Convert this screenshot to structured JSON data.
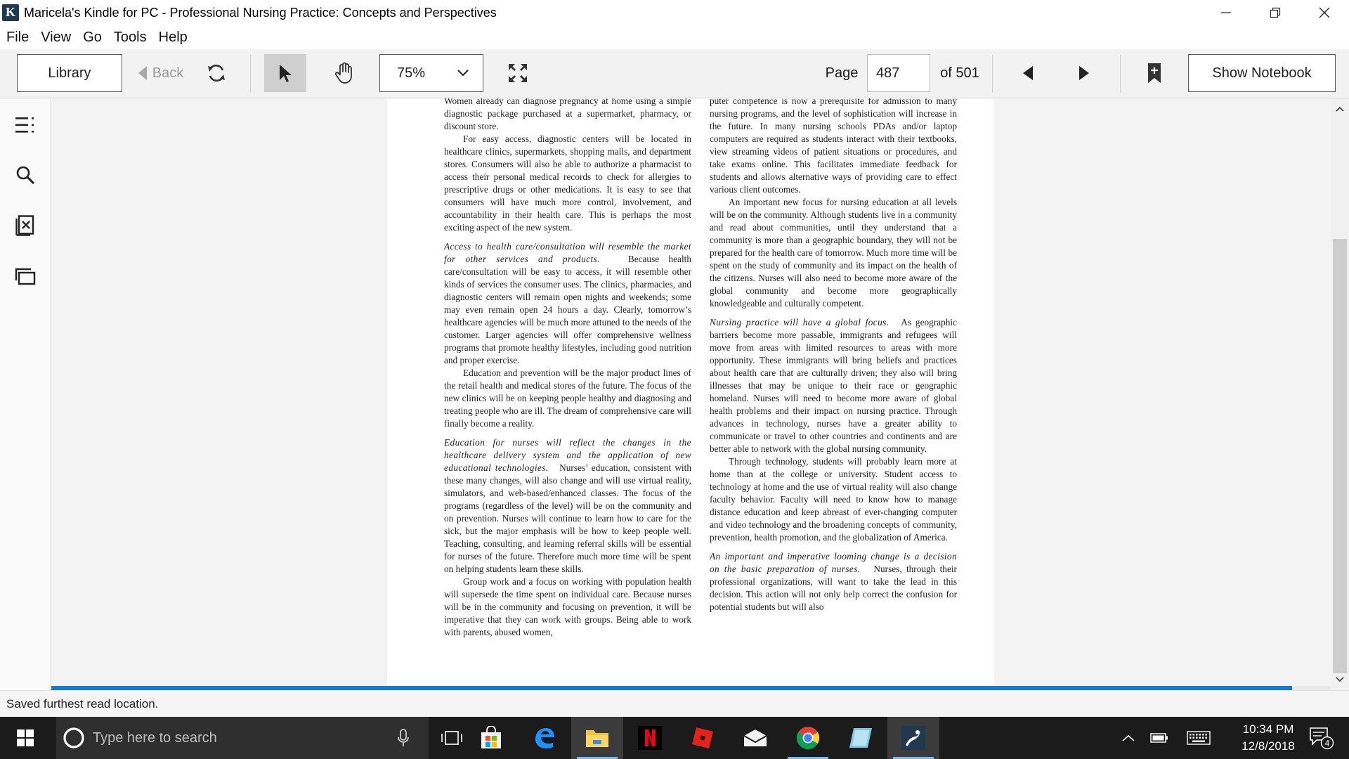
{
  "window": {
    "title": "Maricela's Kindle for PC - Professional Nursing Practice: Concepts and Perspectives"
  },
  "menu": [
    "File",
    "View",
    "Go",
    "Tools",
    "Help"
  ],
  "toolbar": {
    "library_label": "Library",
    "back_label": "Back",
    "zoom_value": "75%",
    "page_label": "Page",
    "page_value": "487",
    "page_total": "of 501",
    "notebook_label": "Show Notebook"
  },
  "reading_progress": 0.97,
  "book": {
    "left_column": [
      {
        "style": "noindent",
        "text": "Women already can diagnose pregnancy at home using a simple diagnostic package purchased at a supermarket, pharmacy, or discount store."
      },
      {
        "style": "indent",
        "text": "For easy access, diagnostic centers will be located in healthcare clinics, supermarkets, shopping malls, and department stores. Consumers will also be able to authorize a pharmacist to access their personal medical records to check for allergies to prescriptive drugs or other medications. It is easy to see that consumers will have much more control, involvement, and accountability in their health care. This is perhaps the most exciting aspect of the new system."
      },
      {
        "style": "head",
        "italic": "Access to health care/consultation will resemble the market for other services and products.",
        "text": "Because health care/consultation will be easy to access, it will resemble other kinds of services the consumer uses. The clinics, pharmacies, and diagnostic centers will remain open nights and weekends; some may even remain open 24 hours a day. Clearly, tomorrow’s healthcare agencies will be much more attuned to the needs of the customer. Larger agencies will offer comprehensive wellness programs that promote healthy lifestyles, including good nutrition and proper exercise."
      },
      {
        "style": "indent",
        "text": "Education and prevention will be the major product lines of the retail health and medical stores of the future. The focus of the new clinics will be on keeping people healthy and diagnosing and treating people who are ill. The dream of comprehensive care will finally become a reality."
      },
      {
        "style": "head",
        "italic": "Education for nurses will reflect the changes in the healthcare delivery system and the application of new educational technologies.",
        "text": "Nurses’ education, consistent with these many changes, will also change and will use virtual reality, simulators, and web-based/enhanced classes. The focus of the programs (regardless of the level) will be on the community and on prevention. Nurses will continue to learn how to care for the sick, but the major emphasis will be how to keep people well. Teaching, consulting, and learning referral skills will be essential for nurses of the future. Therefore much more time will be spent on helping students learn these skills."
      },
      {
        "style": "indent",
        "text": "Group work and a focus on working with population health will supersede the time spent on individual care. Because nurses will be in the community and focusing on prevention, it will be imperative that they can work with groups. Being able to work with parents, abused women,"
      }
    ],
    "right_column": [
      {
        "style": "noindent",
        "text": "puter competence is now a prerequisite for admission to many nursing programs, and the level of sophistication will increase in the future. In many nursing schools PDAs and/or laptop computers are required as students interact with their textbooks, view streaming videos of patient situations or procedures, and take exams online. This facilitates immediate feedback for students and allows alternative ways of providing care to effect various client outcomes."
      },
      {
        "style": "indent",
        "text": "An important new focus for nursing education at all levels will be on the community. Although students live in a community and read about communities, until they understand that a community is more than a geographic boundary, they will not be prepared for the health care of tomorrow. Much more time will be spent on the study of community and its impact on the health of the citizens. Nurses will also need to become more aware of the global community and become more geographically knowledgeable and culturally competent."
      },
      {
        "style": "head",
        "italic": "Nursing practice will have a global focus.",
        "text": "As geographic barriers become more passable, immigrants and refugees will move from areas with limited resources to areas with more opportunity. These immigrants will bring beliefs and practices about health care that are culturally driven; they also will bring illnesses that may be unique to their race or geographic homeland. Nurses will need to become more aware of global health problems and their impact on nursing practice. Through advances in technology, nurses have a greater ability to communicate or travel to other countries and continents and are better able to network with the global nursing community."
      },
      {
        "style": "indent",
        "text": "Through technology, students will probably learn more at home than at the college or university. Student access to technology at home and the use of virtual reality will also change faculty behavior. Faculty will need to know how to manage distance education and keep abreast of ever-changing computer and video technology and the broadening concepts of community, prevention, health promotion, and the globalization of America."
      },
      {
        "style": "head",
        "italic": "An important and imperative looming change is a decision on the basic preparation of nurses.",
        "text": "Nurses, through their professional organizations, will want to take the lead in this decision. This action will not only help correct the confusion for potential students but will also"
      }
    ]
  },
  "status": {
    "message": "Saved furthest read location."
  },
  "taskbar": {
    "search_placeholder": "Type here to search",
    "time": "10:34 PM",
    "date": "12/8/2018",
    "notification_count": "4"
  },
  "colors": {
    "progress_fill": "#1a77c9",
    "taskbar_bg": "#1b1b1b",
    "toolbar_bg": "#f2f2f2"
  }
}
